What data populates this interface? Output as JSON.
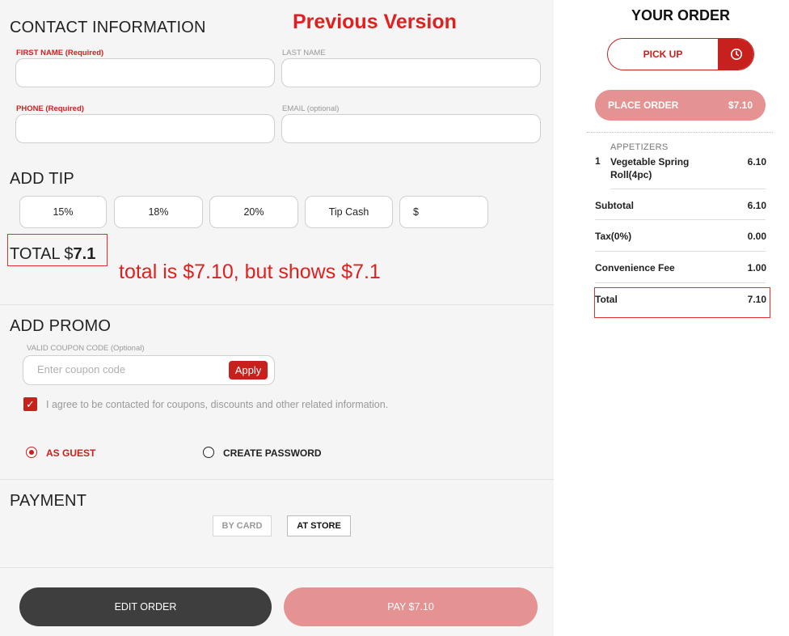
{
  "annotations": {
    "version_label": "Previous Version",
    "note": "total is $7.10, but shows $7.1"
  },
  "contact": {
    "title": "CONTACT INFORMATION",
    "first_name_label": "FIRST NAME (Required)",
    "last_name_label": "LAST NAME",
    "phone_label": "PHONE (Required)",
    "email_label": "EMAIL (optional)"
  },
  "tip": {
    "title": "ADD TIP",
    "options": [
      "15%",
      "18%",
      "20%",
      "Tip Cash"
    ],
    "custom_symbol": "$",
    "total_prefix": "TOTAL $",
    "total_value": "7.1"
  },
  "promo": {
    "title": "ADD PROMO",
    "coupon_label": "VALID COUPON CODE (Optional)",
    "coupon_placeholder": "Enter coupon code",
    "apply_label": "Apply",
    "agree_text": "I agree to be contacted for coupons, discounts and other related information.",
    "agree_checked": true
  },
  "account": {
    "guest_label": "AS GUEST",
    "create_label": "CREATE PASSWORD",
    "selected": "guest"
  },
  "payment": {
    "title": "PAYMENT",
    "by_card": "BY CARD",
    "at_store": "AT STORE"
  },
  "actions": {
    "edit_order": "EDIT ORDER",
    "pay": "PAY $7.10"
  },
  "order": {
    "title": "YOUR ORDER",
    "pickup_label": "PICK UP",
    "place_order_label": "PLACE ORDER",
    "place_order_amount": "$7.10",
    "category": "APPETIZERS",
    "item": {
      "qty": "1",
      "name": "Vegetable Spring Roll(4pc)",
      "price": "6.10"
    },
    "subtotal_label": "Subtotal",
    "subtotal": "6.10",
    "tax_label": "Tax(0%)",
    "tax": "0.00",
    "fee_label": "Convenience Fee",
    "fee": "1.00",
    "total_label": "Total",
    "total": "7.10"
  },
  "colors": {
    "accent": "#c8201c",
    "accent_light": "#e49292",
    "annotation": "#e0201e",
    "dark_button": "#3e3e3e"
  }
}
